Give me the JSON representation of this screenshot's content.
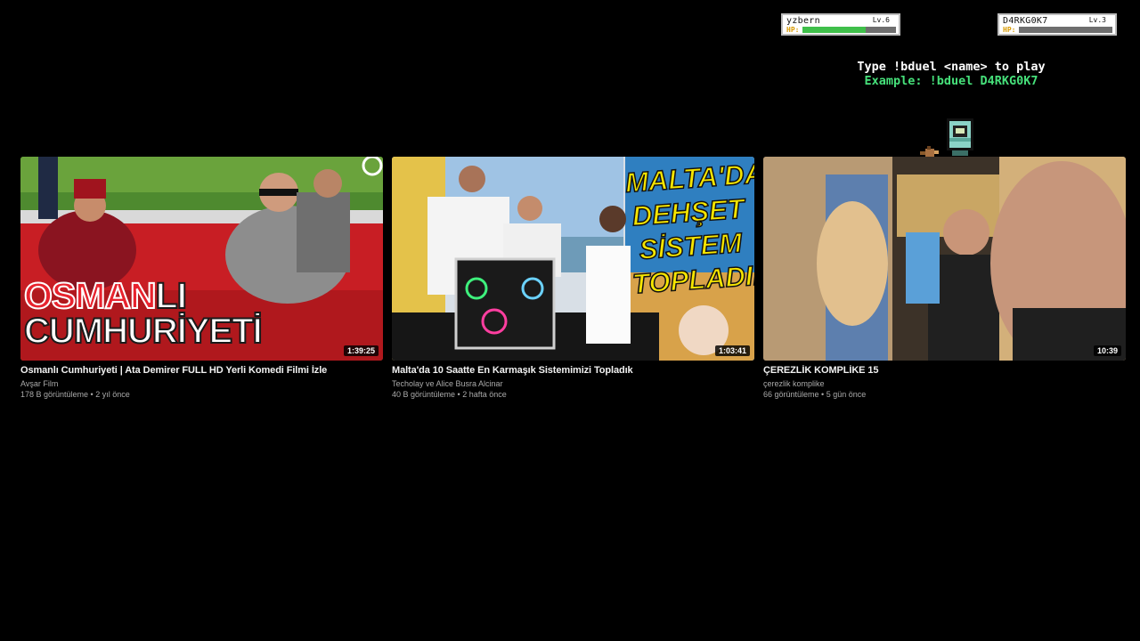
{
  "overlay": {
    "players": [
      {
        "name": "yzbern",
        "level": "Lv.6",
        "hp_label": "HP:",
        "hp_fraction": 0.68
      },
      {
        "name": "D4RKG0K7",
        "level": "Lv.3",
        "hp_label": "HP:",
        "hp_fraction": 0.0
      }
    ],
    "instruction": "Type !bduel <name> to play",
    "example": "Example: !bduel D4RKG0K7",
    "colors": {
      "hp_green": "#3fbf4a",
      "example_green": "#46e07a"
    }
  },
  "videos": [
    {
      "title": "Osmanlı Cumhuriyeti | Ata Demirer FULL HD Yerli Komedi Filmi İzle",
      "channel": "Avşar Film",
      "views": "178 B görüntüleme",
      "age": "2 yıl önce",
      "meta": "178 B görüntüleme • 2 yıl önce",
      "duration": "1:39:25",
      "thumb_text_red": "OSMAN",
      "thumb_text_white": "LI",
      "thumb_text_line2": "CUMHURİYETİ"
    },
    {
      "title": "Malta'da 10 Saatte En Karmaşık Sistemimizi Topladık",
      "channel": "Techolay ve Alice Busra Alcinar",
      "views": "40 B görüntüleme",
      "age": "2 hafta önce",
      "meta": "40 B görüntüleme • 2 hafta önce",
      "duration": "1:03:41",
      "thumb_text_lines": [
        "MALTA'DA",
        "DEHŞET",
        "SİSTEM",
        "TOPLADIK"
      ]
    },
    {
      "title": "ÇEREZLİK KOMPLİKE 15",
      "channel": "çerezlik komplike",
      "views": "66 görüntüleme",
      "age": "5 gün önce",
      "meta": "66 görüntüleme • 5 gün önce",
      "duration": "10:39"
    }
  ]
}
